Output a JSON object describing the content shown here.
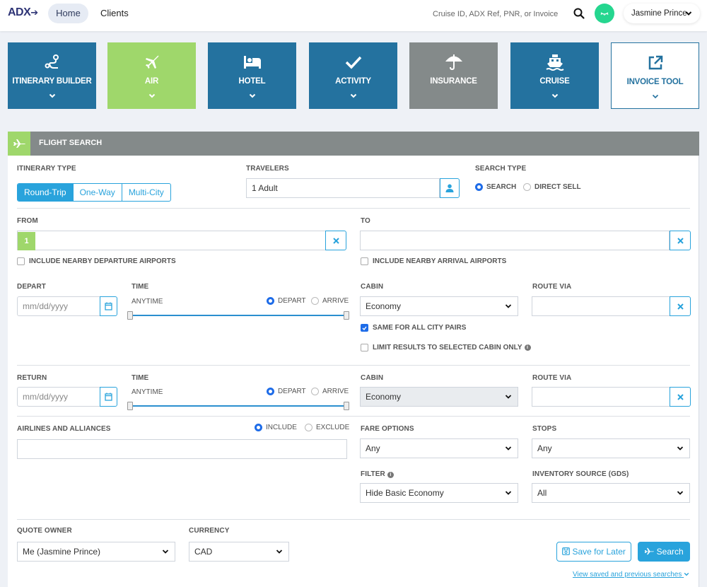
{
  "brand": {
    "logo": "ADX",
    "accent": "#29a3dc",
    "tile_blue": "#24729f",
    "active_green": "#9fd76b",
    "gray": "#848a8a"
  },
  "nav": {
    "items": [
      {
        "label": "Home",
        "active": true
      },
      {
        "label": "Clients",
        "active": false
      }
    ],
    "search_placeholder": "Cruise ID, ADX Ref, PNR, or Invoice #",
    "user_name": "Jasmine Prince"
  },
  "tiles": [
    {
      "label": "ITINERARY BUILDER",
      "icon": "route-icon",
      "state": "default"
    },
    {
      "label": "AIR",
      "icon": "plane-icon",
      "state": "active"
    },
    {
      "label": "HOTEL",
      "icon": "bed-icon",
      "state": "default"
    },
    {
      "label": "ACTIVITY",
      "icon": "check-icon",
      "state": "default"
    },
    {
      "label": "INSURANCE",
      "icon": "umbrella-icon",
      "state": "disabled"
    },
    {
      "label": "CRUISE",
      "icon": "ship-icon",
      "state": "default"
    },
    {
      "label": "INVOICE TOOL",
      "icon": "external-link-icon",
      "state": "outline"
    }
  ],
  "flight_search": {
    "title": "FLIGHT SEARCH",
    "itinerary_type": {
      "label": "ITINERARY TYPE",
      "options": [
        "Round-Trip",
        "One-Way",
        "Multi-City"
      ],
      "selected": "Round-Trip"
    },
    "travelers": {
      "label": "TRAVELERS",
      "value": "1 Adult"
    },
    "search_type": {
      "label": "SEARCH TYPE",
      "options": [
        "SEARCH",
        "DIRECT SELL"
      ],
      "selected": "SEARCH"
    },
    "from": {
      "label": "FROM",
      "segment_number": "1",
      "value": "",
      "nearby_label": "INCLUDE NEARBY DEPARTURE AIRPORTS",
      "nearby_checked": false
    },
    "to": {
      "label": "TO",
      "value": "",
      "nearby_label": "INCLUDE NEARBY ARRIVAL AIRPORTS",
      "nearby_checked": false
    },
    "depart": {
      "label": "DEPART",
      "date_placeholder": "mm/dd/yyyy",
      "time_label": "TIME",
      "time_value": "ANYTIME",
      "time_mode_options": [
        "DEPART",
        "ARRIVE"
      ],
      "time_mode_selected": "DEPART",
      "time_range": [
        0,
        1
      ],
      "cabin_label": "CABIN",
      "cabin_value": "Economy",
      "route_via_label": "ROUTE VIA",
      "route_via_value": "",
      "same_for_all_label": "SAME FOR ALL CITY PAIRS",
      "same_for_all_checked": true,
      "limit_cabin_label": "LIMIT RESULTS TO SELECTED CABIN ONLY",
      "limit_cabin_checked": false
    },
    "return": {
      "label": "RETURN",
      "date_placeholder": "mm/dd/yyyy",
      "time_label": "TIME",
      "time_value": "ANYTIME",
      "time_mode_options": [
        "DEPART",
        "ARRIVE"
      ],
      "time_mode_selected": "DEPART",
      "time_range": [
        0,
        1
      ],
      "cabin_label": "CABIN",
      "cabin_value": "Economy",
      "route_via_label": "ROUTE VIA",
      "route_via_value": ""
    },
    "airlines": {
      "label": "AIRLINES AND ALLIANCES",
      "mode_options": [
        "INCLUDE",
        "EXCLUDE"
      ],
      "mode_selected": "INCLUDE",
      "value": ""
    },
    "fare_options": {
      "label": "FARE OPTIONS",
      "value": "Any"
    },
    "stops": {
      "label": "STOPS",
      "value": "Any"
    },
    "filter": {
      "label": "FILTER",
      "value": "Hide Basic Economy"
    },
    "inventory_source": {
      "label": "INVENTORY SOURCE (GDS)",
      "value": "All"
    },
    "quote_owner": {
      "label": "QUOTE OWNER",
      "value": "Me (Jasmine Prince)"
    },
    "currency": {
      "label": "CURRENCY",
      "value": "CAD"
    },
    "save_label": "Save for Later",
    "search_label": "Search",
    "view_saved_label": "View saved and previous searches"
  }
}
